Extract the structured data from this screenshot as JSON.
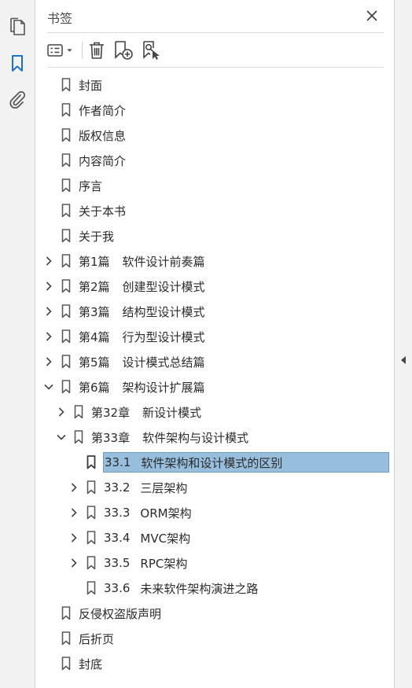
{
  "panel": {
    "title": "书签"
  },
  "rail_icons": [
    "pages-icon",
    "bookmark-icon",
    "attachment-icon"
  ],
  "accent_color": "#1a73c9",
  "selection_color": "#97bfdd",
  "bookmarks": [
    {
      "label": "封面"
    },
    {
      "label": "作者简介"
    },
    {
      "label": "版权信息"
    },
    {
      "label": "内容简介"
    },
    {
      "label": "序言"
    },
    {
      "label": "关于本书"
    },
    {
      "label": "关于我"
    },
    {
      "num": "第1篇",
      "label": "软件设计前奏篇"
    },
    {
      "num": "第2篇",
      "label": "创建型设计模式"
    },
    {
      "num": "第3篇",
      "label": "结构型设计模式"
    },
    {
      "num": "第4篇",
      "label": "行为型设计模式"
    },
    {
      "num": "第5篇",
      "label": "设计模式总结篇"
    },
    {
      "num": "第6篇",
      "label": "架构设计扩展篇"
    },
    {
      "num": "第32章",
      "label": "新设计模式"
    },
    {
      "num": "第33章",
      "label": "软件架构与设计模式"
    },
    {
      "num": "33.1",
      "label": "软件架构和设计模式的区别"
    },
    {
      "num": "33.2",
      "label": "三层架构"
    },
    {
      "num": "33.3",
      "label": "ORM架构"
    },
    {
      "num": "33.4",
      "label": "MVC架构"
    },
    {
      "num": "33.5",
      "label": "RPC架构"
    },
    {
      "num": "33.6",
      "label": "未来软件架构演进之路"
    },
    {
      "label": "反侵权盗版声明"
    },
    {
      "label": "后折页"
    },
    {
      "label": "封底"
    }
  ]
}
